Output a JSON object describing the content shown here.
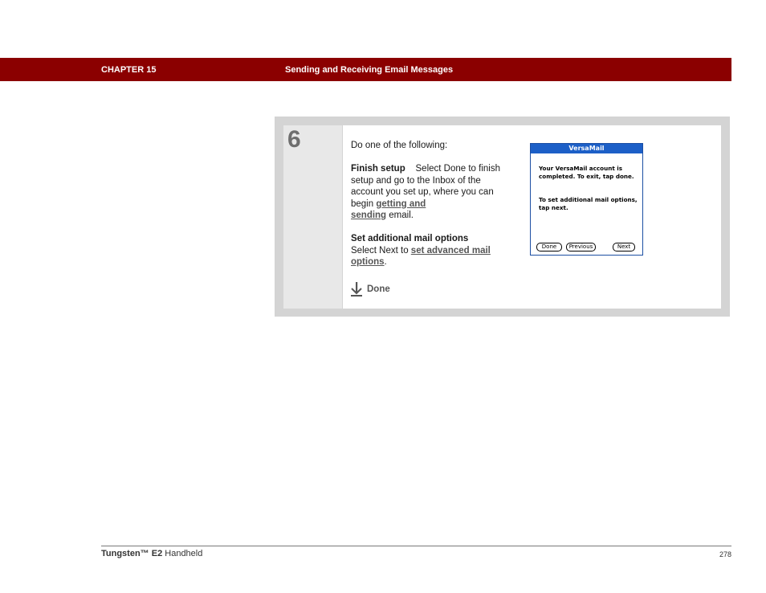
{
  "header": {
    "chapter": "CHAPTER 15",
    "title": "Sending and Receiving Email Messages"
  },
  "step": {
    "number": "6",
    "intro": "Do one of the following:",
    "option1": {
      "label": "Finish setup",
      "text_before": "Select Done to finish setup and go to the Inbox of the account you set up, where you can begin ",
      "link_text_1": "getting and ",
      "link_text_2": "sending",
      "text_after": " email."
    },
    "option2": {
      "label": "Set additional mail options",
      "text_before": "Select Next to ",
      "link_text_1": "set advanced mail ",
      "link_text_2": "options",
      "text_after": "."
    },
    "done_label": "Done",
    "done_icon": "down-arrow-icon"
  },
  "screenshot": {
    "title": "VersaMail",
    "message1": "Your VersaMail account is completed. To exit, tap done.",
    "message2": "To set additional mail options, tap next.",
    "buttons": {
      "done": "Done",
      "previous": "Previous",
      "next": "Next"
    },
    "title_color": "#1c5fc7"
  },
  "footer": {
    "product_brand": "Tungsten™ E2",
    "product_suffix": " Handheld",
    "page_number": "278"
  },
  "colors": {
    "header_bar": "#8b0000",
    "frame": "#d4d4d4"
  }
}
